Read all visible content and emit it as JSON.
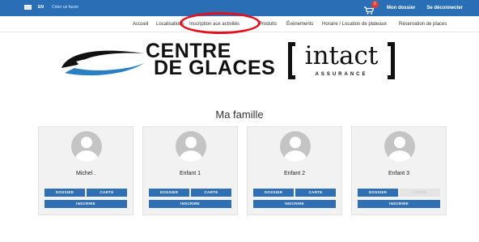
{
  "topbar": {
    "language": "EN",
    "create_account": "Créer un favori",
    "cart_count": "0",
    "my_file": "Mon dossier",
    "logout": "Se déconnecter"
  },
  "nav": {
    "items": [
      "Accueil",
      "Localisations",
      "Inscription aux activités",
      "Produits",
      "Événements",
      "Horaire / Location de plateaux",
      "Réservation de places"
    ]
  },
  "logos": {
    "centre_line1": "CENTRE",
    "centre_line2": "DE GLACES",
    "intact_word": "intact",
    "intact_sub": "ASSURANCE"
  },
  "page": {
    "title": "Ma famille"
  },
  "members": [
    {
      "name": "Michel .",
      "dossier_label": "DOSSIER",
      "carte_label": "CARTE",
      "inscrire_label": "INSCRIRE",
      "carte_enabled": true
    },
    {
      "name": "Enfant 1",
      "dossier_label": "DOSSIER",
      "carte_label": "CARTE",
      "inscrire_label": "INSCRIRE",
      "carte_enabled": true
    },
    {
      "name": "Enfant 2",
      "dossier_label": "DOSSIER",
      "carte_label": "CARTE",
      "inscrire_label": "INSCRIRE",
      "carte_enabled": true
    },
    {
      "name": "Enfant 3",
      "dossier_label": "DOSSIER",
      "carte_label": "CARTE",
      "inscrire_label": "INSCRIRE",
      "carte_enabled": false
    }
  ],
  "colors": {
    "topbar": "#2a6fb5",
    "button": "#2f6fb3",
    "highlight": "#e3101d"
  }
}
